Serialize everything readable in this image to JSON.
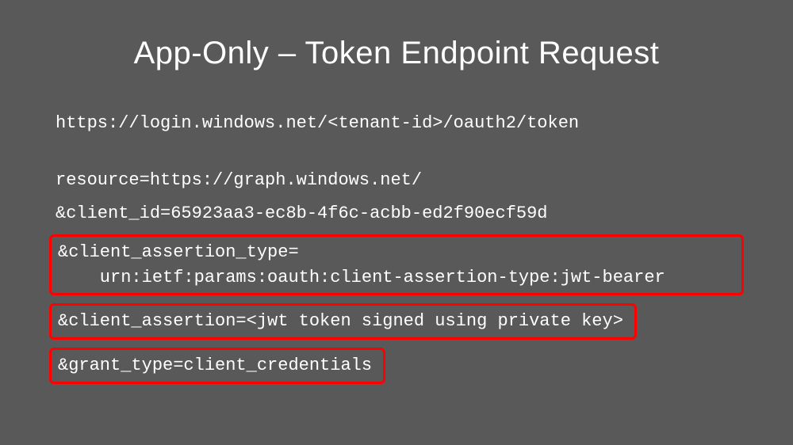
{
  "title": "App-Only – Token Endpoint Request",
  "url_line": "https://login.windows.net/<tenant-id>/oauth2/token",
  "param_resource": "resource=https://graph.windows.net/",
  "param_client_id": "&client_id=65923aa3-ec8b-4f6c-acbb-ed2f90ecf59d",
  "box1_line1": "&client_assertion_type=",
  "box1_line2": "    urn:ietf:params:oauth:client-assertion-type:jwt-bearer",
  "box2_line": "&client_assertion=<jwt token signed using private key>",
  "box3_line": "&grant_type=client_credentials"
}
